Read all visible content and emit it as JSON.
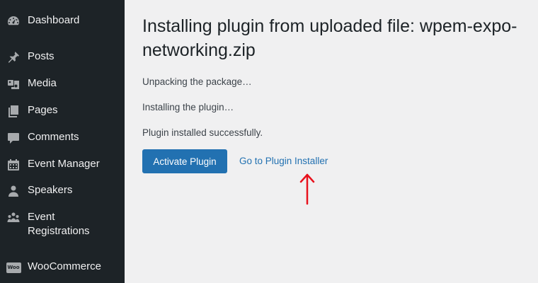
{
  "sidebar": {
    "items": [
      {
        "label": "Dashboard",
        "icon": "dashboard-icon"
      },
      {
        "label": "Posts",
        "icon": "pin-icon"
      },
      {
        "label": "Media",
        "icon": "media-icon"
      },
      {
        "label": "Pages",
        "icon": "pages-icon"
      },
      {
        "label": "Comments",
        "icon": "comment-icon"
      },
      {
        "label": "Event Manager",
        "icon": "calendar-icon"
      },
      {
        "label": "Speakers",
        "icon": "person-icon"
      },
      {
        "label": "Event Registrations",
        "icon": "group-icon"
      },
      {
        "label": "WooCommerce",
        "icon": "woo-icon",
        "badge": "Woo"
      }
    ]
  },
  "main": {
    "title": "Installing plugin from uploaded file: wpem-expo-networking.zip",
    "steps": [
      "Unpacking the package…",
      "Installing the plugin…",
      "Plugin installed successfully."
    ],
    "activate_label": "Activate Plugin",
    "installer_link": "Go to Plugin Installer"
  },
  "colors": {
    "sidebar_bg": "#1d2327",
    "page_bg": "#f0f0f1",
    "primary": "#2271b1",
    "annotation": "#e8111c"
  }
}
